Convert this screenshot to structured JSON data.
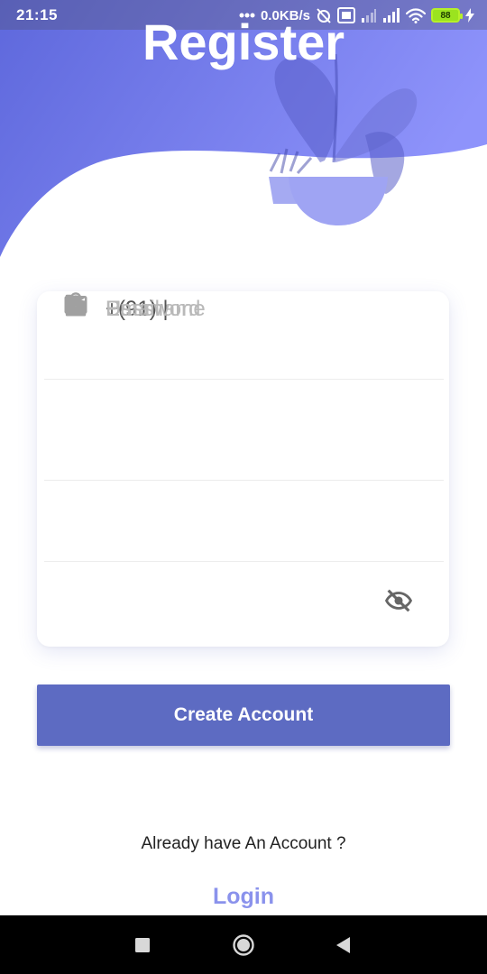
{
  "status_bar": {
    "time": "21:15",
    "network_speed": "0.0KB/s",
    "battery": "88"
  },
  "page": {
    "title": "Register"
  },
  "form": {
    "username_placeholder": "Username",
    "phone_value": "+(91) |",
    "email_placeholder": "Email",
    "password_placeholder": "Password"
  },
  "actions": {
    "create_account_label": "Create Account",
    "already_have_account": "Already have An Account ?",
    "login_label": "Login"
  },
  "icons": {
    "username": "person-icon",
    "phone": "phone-icon",
    "email": "mail-icon",
    "password": "lock-icon",
    "visibility": "eye-off-icon"
  },
  "colors": {
    "primary": "#5d6bc2",
    "header_gradient_start": "#5e68dc",
    "header_gradient_end": "#8e93fb",
    "link": "#8a92ec",
    "icon": "#a0a0a0",
    "placeholder": "#b9b9b9"
  }
}
